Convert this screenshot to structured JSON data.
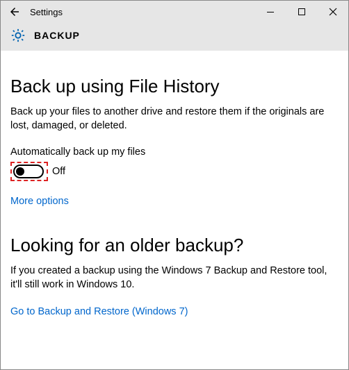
{
  "titlebar": {
    "title": "Settings"
  },
  "header": {
    "label": "BACKUP"
  },
  "section1": {
    "heading": "Back up using File History",
    "body": "Back up your files to another drive and restore them if the originals are lost, damaged, or deleted.",
    "toggle_label": "Automatically back up my files",
    "toggle_state": "Off",
    "link": "More options"
  },
  "section2": {
    "heading": "Looking for an older backup?",
    "body": "If you created a backup using the Windows 7 Backup and Restore tool, it'll still work in Windows 10.",
    "link": "Go to Backup and Restore (Windows 7)"
  },
  "colors": {
    "link": "#0066cc",
    "headerbg": "#e6e6e6",
    "highlight": "#d22"
  }
}
